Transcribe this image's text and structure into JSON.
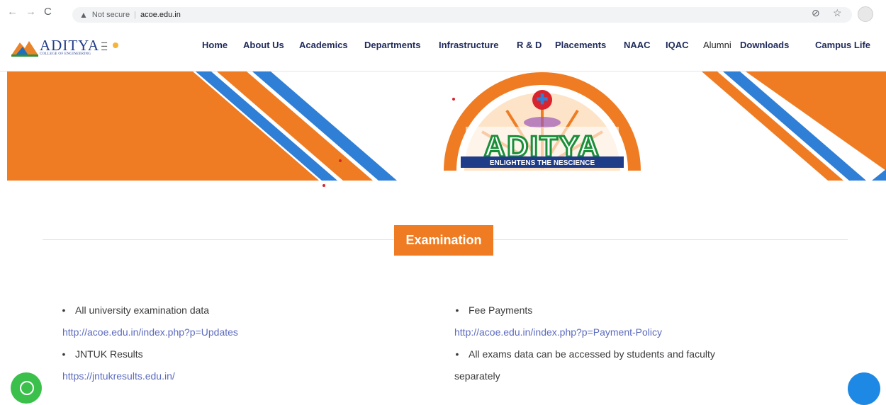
{
  "browser": {
    "security_label": "Not secure",
    "url": "acoe.edu.in"
  },
  "brand": {
    "name": "ADITYA",
    "subtitle": "COLLEGE OF ENGINEERING"
  },
  "nav": [
    "Home",
    "About Us",
    "Academics",
    "Departments",
    "Infrastructure",
    "R & D",
    "Placements",
    "NAAC",
    "IQAC",
    "Alumni",
    "Downloads",
    "Campus Life"
  ],
  "emblem": {
    "name": "ADITYA",
    "tagline": "ENLIGHTENS THE NESCIENCE"
  },
  "section": {
    "title": "Examination"
  },
  "content": {
    "left": {
      "item1": "All university examination data",
      "link1": "http://acoe.edu.in/index.php?p=Updates",
      "item2": "JNTUK Results",
      "link2": "https://jntukresults.edu.in/"
    },
    "right": {
      "item1": "Fee Payments",
      "link1": "http://acoe.edu.in/index.php?p=Payment-Policy",
      "item2": "All exams data can be accessed by students and faculty",
      "item2_cont": "separately"
    }
  },
  "colors": {
    "orange": "#ef7c22",
    "blue": "#2f7fd6",
    "navy": "#1e2a5a"
  }
}
